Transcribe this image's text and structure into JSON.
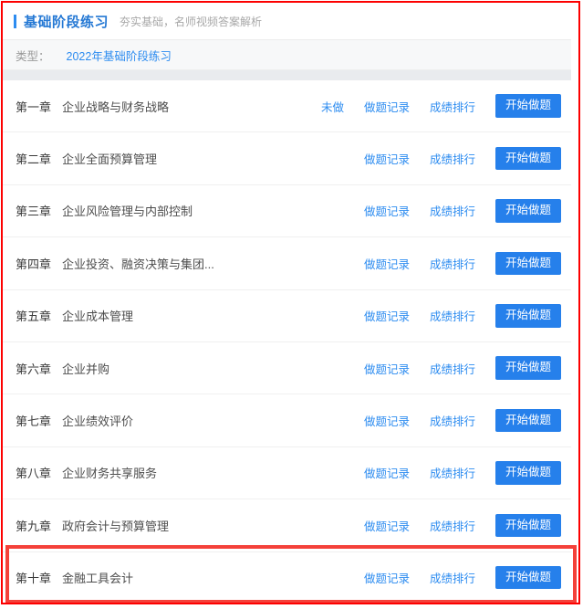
{
  "header": {
    "title": "基础阶段练习",
    "subtitle": "夯实基础，名师视频答案解析",
    "accent_color": "#2d8cf0"
  },
  "filter": {
    "label": "类型：",
    "selected": "2022年基础阶段练习"
  },
  "actions": {
    "record_label": "做题记录",
    "rank_label": "成绩排行",
    "start_label": "开始做题",
    "undone_label": "未做"
  },
  "colors": {
    "link": "#2d8cf0",
    "button": "#2680eb",
    "highlight": "#f4413a",
    "frame": "#fd0000"
  },
  "chapters": [
    {
      "no": "第一章",
      "title": "企业战略与财务战略",
      "status": "未做"
    },
    {
      "no": "第二章",
      "title": "企业全面预算管理",
      "status": ""
    },
    {
      "no": "第三章",
      "title": "企业风险管理与内部控制",
      "status": ""
    },
    {
      "no": "第四章",
      "title": "企业投资、融资决策与集团...",
      "status": ""
    },
    {
      "no": "第五章",
      "title": "企业成本管理",
      "status": ""
    },
    {
      "no": "第六章",
      "title": "企业并购",
      "status": ""
    },
    {
      "no": "第七章",
      "title": "企业绩效评价",
      "status": ""
    },
    {
      "no": "第八章",
      "title": "企业财务共享服务",
      "status": ""
    },
    {
      "no": "第九章",
      "title": "政府会计与预算管理",
      "status": ""
    },
    {
      "no": "第十章",
      "title": "金融工具会计",
      "status": ""
    }
  ]
}
